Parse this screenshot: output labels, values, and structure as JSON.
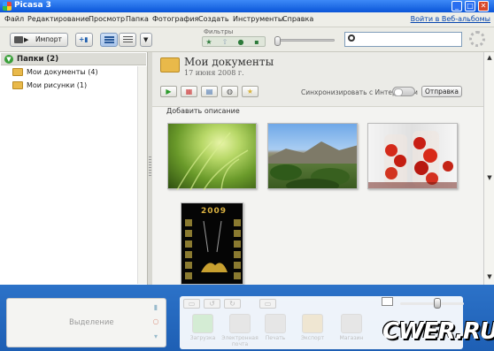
{
  "window": {
    "title": "Picasa 3"
  },
  "menu": {
    "items": [
      "Файл",
      "Редактирование",
      "Просмотр",
      "Папка",
      "Фотография",
      "Создать",
      "Инструменты",
      "Справка"
    ],
    "web_albums_link": "Войти в Веб-альбомы"
  },
  "toolbar": {
    "import_label": "Импорт",
    "filters_label": "Фильтры",
    "search": {
      "value": "",
      "placeholder": ""
    }
  },
  "sidebar": {
    "header": "Папки (2)",
    "folders": [
      {
        "label": "Мои документы (4)"
      },
      {
        "label": "Мои рисунки (1)"
      }
    ]
  },
  "album": {
    "title": "Мои документы",
    "date": "17 июня 2008 г.",
    "sync_label": "Синхронизировать с Интернетом",
    "send_button": "Отправка",
    "add_description": "Добавить описание",
    "photos": [
      {
        "name": "grass-photo",
        "colors": [
          "#c8e088",
          "#6a9a2a",
          "#2f5010"
        ]
      },
      {
        "name": "mountain-photo",
        "colors": [
          "#7fb0e8",
          "#8a8470",
          "#4a6a2a"
        ]
      },
      {
        "name": "tomato-jars-photo",
        "colors": [
          "#f0f0f0",
          "#d03020",
          "#6a1810"
        ]
      },
      {
        "name": "calendar-2009-photo",
        "colors": [
          "#000000",
          "#c8a040",
          "#6a5010"
        ],
        "text": "2009"
      }
    ]
  },
  "tray": {
    "selection_label": "Выделение",
    "actions": [
      {
        "label": "Загрузка"
      },
      {
        "label": "Электронная почта"
      },
      {
        "label": "Печать"
      },
      {
        "label": "Экспорт"
      },
      {
        "label": "Магазин"
      }
    ],
    "watermark": "CWER.RU"
  },
  "colors": {
    "titlebar": "#0a55d8",
    "tray": "#1e5fb4",
    "link": "#0645ad"
  }
}
